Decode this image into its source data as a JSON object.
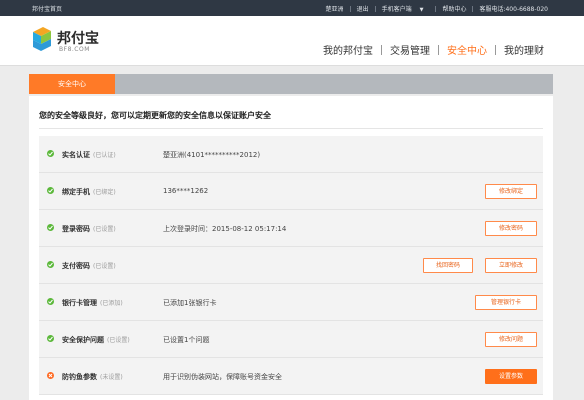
{
  "topbar": {
    "home_label": "邦付宝首页",
    "username": "楚亚洲",
    "logout_label": "退出",
    "mobile_client_label": "手机客户端",
    "help_label": "帮助中心",
    "hotline": "客服电话:400-6688-020"
  },
  "header": {
    "logo_text": "邦付宝",
    "logo_sub": "BF8.COM",
    "nav": [
      {
        "label": "我的邦付宝"
      },
      {
        "label": "交易管理"
      },
      {
        "label": "安全中心"
      },
      {
        "label": "我的理财"
      }
    ]
  },
  "tabs": {
    "active_label": "安全中心"
  },
  "panel": {
    "notice": "您的安全等级良好，您可以定期更新您的安全信息以保证账户安全"
  },
  "rows": [
    {
      "title": "实名认证",
      "status_text": "(已认证)",
      "info": "楚亚洲(4101**********2012)",
      "status": "ok"
    },
    {
      "title": "绑定手机",
      "status_text": "(已绑定)",
      "info": "136****1262",
      "status": "ok",
      "button": "修改绑定"
    },
    {
      "title": "登录密码",
      "status_text": "(已设置)",
      "info": "上次登录时间：2015-08-12 05:17:14",
      "status": "ok",
      "button": "修改密码"
    },
    {
      "title": "支付密码",
      "status_text": "(已设置)",
      "info": "",
      "status": "ok",
      "button_secondary": "找回密码",
      "button": "立即修改"
    },
    {
      "title": "银行卡管理",
      "status_text": "(已添加)",
      "info": "已添加1张银行卡",
      "status": "ok",
      "button": "管理银行卡"
    },
    {
      "title": "安全保护问题",
      "status_text": "(已设置)",
      "info": "已设置1个问题",
      "status": "ok",
      "button": "修改问题"
    },
    {
      "title": "防钓鱼参数",
      "status_text": "(未设置)",
      "info": "用于识别伪装网站，保障账号资金安全",
      "status": "warn",
      "button": "设置参数"
    }
  ],
  "colors": {
    "accent": "#ff6f1a",
    "ok": "#5bb83a",
    "topbar": "#2f3844"
  }
}
